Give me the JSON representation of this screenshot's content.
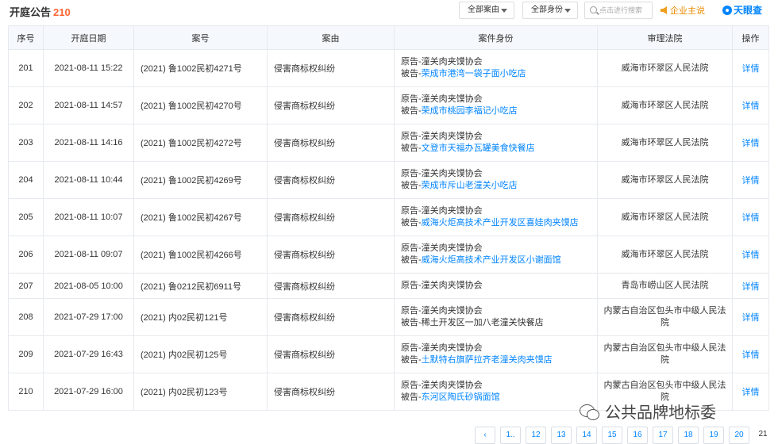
{
  "header": {
    "title": "开庭公告",
    "count": "210",
    "filter_cause": "全部案由",
    "filter_role": "全部身份",
    "search_placeholder": "点击进行搜索",
    "claim_label": "企业主说",
    "brand_label": "天眼查"
  },
  "columns": [
    "序号",
    "开庭日期",
    "案号",
    "案由",
    "案件身份",
    "审理法院",
    "操作"
  ],
  "rows": [
    {
      "no": "201",
      "date": "2021-08-11 15:22",
      "case_no": "(2021) 鲁1002民初4271号",
      "cause": "侵害商标权纠纷",
      "plaintiff": "原告-潼关肉夹馍协会",
      "defendant_prefix": "被告-",
      "defendant": "荣成市港湾一袋子面小吃店",
      "court": "威海市环翠区人民法院",
      "action": "详情"
    },
    {
      "no": "202",
      "date": "2021-08-11 14:57",
      "case_no": "(2021) 鲁1002民初4270号",
      "cause": "侵害商标权纠纷",
      "plaintiff": "原告-潼关肉夹馍协会",
      "defendant_prefix": "被告-",
      "defendant": "荣成市桃园李福记小吃店",
      "court": "威海市环翠区人民法院",
      "action": "详情"
    },
    {
      "no": "203",
      "date": "2021-08-11 14:16",
      "case_no": "(2021) 鲁1002民初4272号",
      "cause": "侵害商标权纠纷",
      "plaintiff": "原告-潼关肉夹馍协会",
      "defendant_prefix": "被告-",
      "defendant": "文登市天福办瓦罐美食快餐店",
      "court": "威海市环翠区人民法院",
      "action": "详情"
    },
    {
      "no": "204",
      "date": "2021-08-11 10:44",
      "case_no": "(2021) 鲁1002民初4269号",
      "cause": "侵害商标权纠纷",
      "plaintiff": "原告-潼关肉夹馍协会",
      "defendant_prefix": "被告-",
      "defendant": "荣成市斥山老潼关小吃店",
      "court": "威海市环翠区人民法院",
      "action": "详情"
    },
    {
      "no": "205",
      "date": "2021-08-11 10:07",
      "case_no": "(2021) 鲁1002民初4267号",
      "cause": "侵害商标权纠纷",
      "plaintiff": "原告-潼关肉夹馍协会",
      "defendant_prefix": "被告-",
      "defendant": "威海火炬高技术产业开发区喜娃肉夹馍店",
      "court": "威海市环翠区人民法院",
      "action": "详情"
    },
    {
      "no": "206",
      "date": "2021-08-11 09:07",
      "case_no": "(2021) 鲁1002民初4266号",
      "cause": "侵害商标权纠纷",
      "plaintiff": "原告-潼关肉夹馍协会",
      "defendant_prefix": "被告-",
      "defendant": "威海火炬高技术产业开发区小谢面馆",
      "court": "威海市环翠区人民法院",
      "action": "详情"
    },
    {
      "no": "207",
      "date": "2021-08-05 10:00",
      "case_no": "(2021) 鲁0212民初6911号",
      "cause": "侵害商标权纠纷",
      "plaintiff": "原告-潼关肉夹馍协会",
      "defendant_prefix": "",
      "defendant": "",
      "court": "青岛市崂山区人民法院",
      "action": "详情"
    },
    {
      "no": "208",
      "date": "2021-07-29 17:00",
      "case_no": "(2021) 内02民初121号",
      "cause": "侵害商标权纠纷",
      "plaintiff": "原告-潼关肉夹馍协会",
      "defendant_prefix": "被告-稀土开发区一加八老潼关快餐店",
      "defendant": "",
      "court": "内蒙古自治区包头市中级人民法院",
      "action": "详情"
    },
    {
      "no": "209",
      "date": "2021-07-29 16:43",
      "case_no": "(2021) 内02民初125号",
      "cause": "侵害商标权纠纷",
      "plaintiff": "原告-潼关肉夹馍协会",
      "defendant_prefix": "被告-",
      "defendant": "土默特右旗萨拉齐老潼关肉夹馍店",
      "court": "内蒙古自治区包头市中级人民法院",
      "action": "详情"
    },
    {
      "no": "210",
      "date": "2021-07-29 16:00",
      "case_no": "(2021) 内02民初123号",
      "cause": "侵害商标权纠纷",
      "plaintiff": "原告-潼关肉夹馍协会",
      "defendant_prefix": "被告-",
      "defendant": "东河区陶氏砂锅面馆",
      "court": "内蒙古自治区包头市中级人民法院",
      "action": "详情"
    }
  ],
  "watermark": "公共品牌地标委",
  "pagination": {
    "prev": "‹",
    "pages": [
      "1..",
      "12",
      "13",
      "14",
      "15",
      "16",
      "17",
      "18",
      "19",
      "20"
    ],
    "last": "21"
  },
  "colors": {
    "link": "#0084ff",
    "count": "#ff6633",
    "claim": "#e98a00",
    "header_bg": "#f5f8fc"
  }
}
